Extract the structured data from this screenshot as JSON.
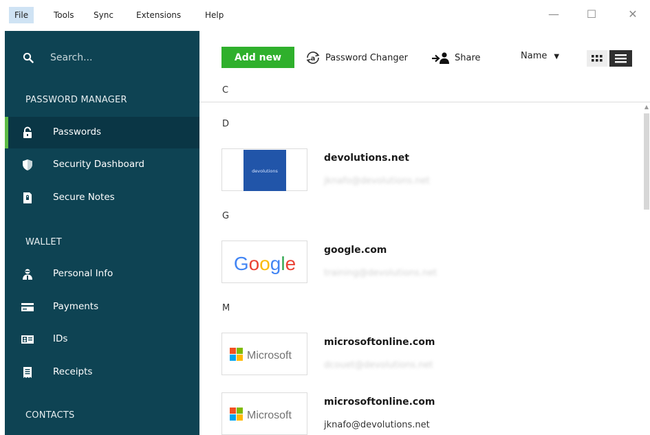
{
  "menu": {
    "items": [
      "File",
      "Tools",
      "Sync",
      "Extensions",
      "Help"
    ]
  },
  "window_controls": {
    "minimize": "—",
    "maximize": "☐",
    "close": "✕"
  },
  "sidebar": {
    "search_placeholder": "Search...",
    "sections": {
      "password_manager": "PASSWORD MANAGER",
      "wallet": "WALLET",
      "contacts": "CONTACTS"
    },
    "items": [
      {
        "label": "Passwords",
        "icon": "lock-icon",
        "active": true
      },
      {
        "label": "Security Dashboard",
        "icon": "shield-icon",
        "active": false
      },
      {
        "label": "Secure Notes",
        "icon": "secure-note-icon",
        "active": false
      },
      {
        "label": "Personal Info",
        "icon": "person-icon",
        "active": false
      },
      {
        "label": "Payments",
        "icon": "credit-card-icon",
        "active": false
      },
      {
        "label": "IDs",
        "icon": "id-card-icon",
        "active": false
      },
      {
        "label": "Receipts",
        "icon": "receipt-icon",
        "active": false
      }
    ],
    "colors": {
      "background": "#0e4353",
      "active_background": "#0a3645",
      "active_accent": "#5dbb46"
    }
  },
  "toolbar": {
    "add_new_label": "Add new",
    "password_changer_label": "Password Changer",
    "share_label": "Share",
    "sort_label": "Name",
    "colors": {
      "add_new": "#2fb02c"
    }
  },
  "list": {
    "letters": [
      "C",
      "D",
      "G",
      "M"
    ],
    "entries": [
      {
        "title": "devolutions.net",
        "logo_text": "devolutions",
        "username": "jknafo@devolutions.net",
        "blurred": true
      },
      {
        "title": "google.com",
        "logo_text": "Google",
        "username": "training@devolutions.net",
        "blurred": true
      },
      {
        "title": "microsoftonline.com",
        "logo_text": "Microsoft",
        "username": "dcouet@devolutions.net",
        "blurred": true
      },
      {
        "title": "microsoftonline.com",
        "logo_text": "Microsoft",
        "username": "jknafo@devolutions.net",
        "blurred": false
      }
    ]
  }
}
